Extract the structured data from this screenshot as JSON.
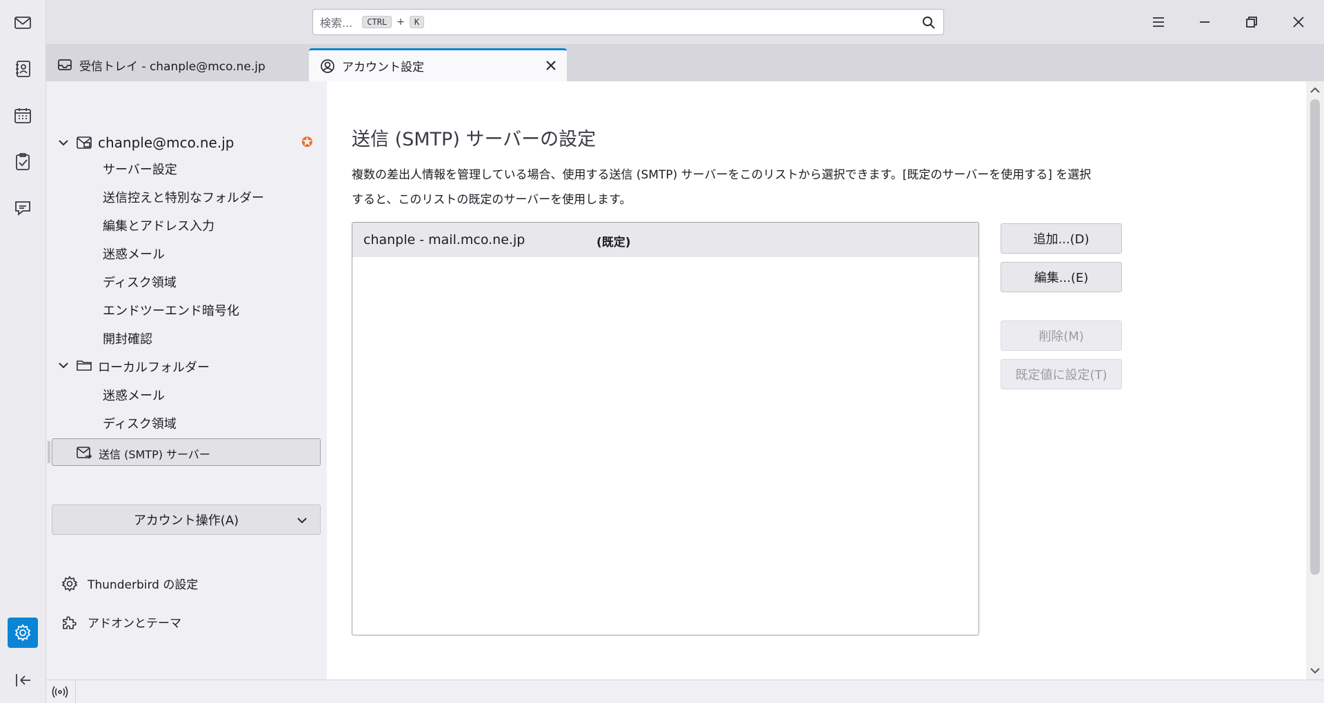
{
  "spaces": [
    {
      "name": "mail-icon"
    },
    {
      "name": "address-book-icon"
    },
    {
      "name": "calendar-icon"
    },
    {
      "name": "tasks-icon"
    },
    {
      "name": "chat-icon"
    },
    {
      "name": "settings-icon"
    },
    {
      "name": "collapse-icon"
    }
  ],
  "search": {
    "placeholder": "検索...",
    "key1": "CTRL",
    "plus": "+",
    "key2": "K"
  },
  "tabs": [
    {
      "label": "受信トレイ - chanple@mco.ne.jp"
    },
    {
      "label": "アカウント設定"
    }
  ],
  "tree": {
    "account": "chanple@mco.ne.jp",
    "account_items": [
      "サーバー設定",
      "送信控えと特別なフォルダー",
      "編集とアドレス入力",
      "迷惑メール",
      "ディスク領域",
      "エンドツーエンド暗号化",
      "開封確認"
    ],
    "local": "ローカルフォルダー",
    "local_items": [
      "迷惑メール",
      "ディスク領域"
    ],
    "smtp": "送信 (SMTP) サーバー"
  },
  "account_actions": "アカウント操作(A)",
  "bottom_links": {
    "settings": "Thunderbird の設定",
    "addons": "アドオンとテーマ"
  },
  "main": {
    "title": "送信 (SMTP) サーバーの設定",
    "description": "複数の差出人情報を管理している場合、使用する送信 (SMTP) サーバーをこのリストから選択できます。[既定のサーバーを使用する] を選択すると、このリストの既定のサーバーを使用します。",
    "server_name": "chanple - mail.mco.ne.jp",
    "server_default": "(既定)",
    "buttons": {
      "add": "追加...(D)",
      "edit": "編集...(E)",
      "delete": "削除(M)",
      "set_default": "既定値に設定(T)"
    }
  },
  "colors": {
    "accent": "#0a84d4",
    "star": "#e8702a"
  }
}
